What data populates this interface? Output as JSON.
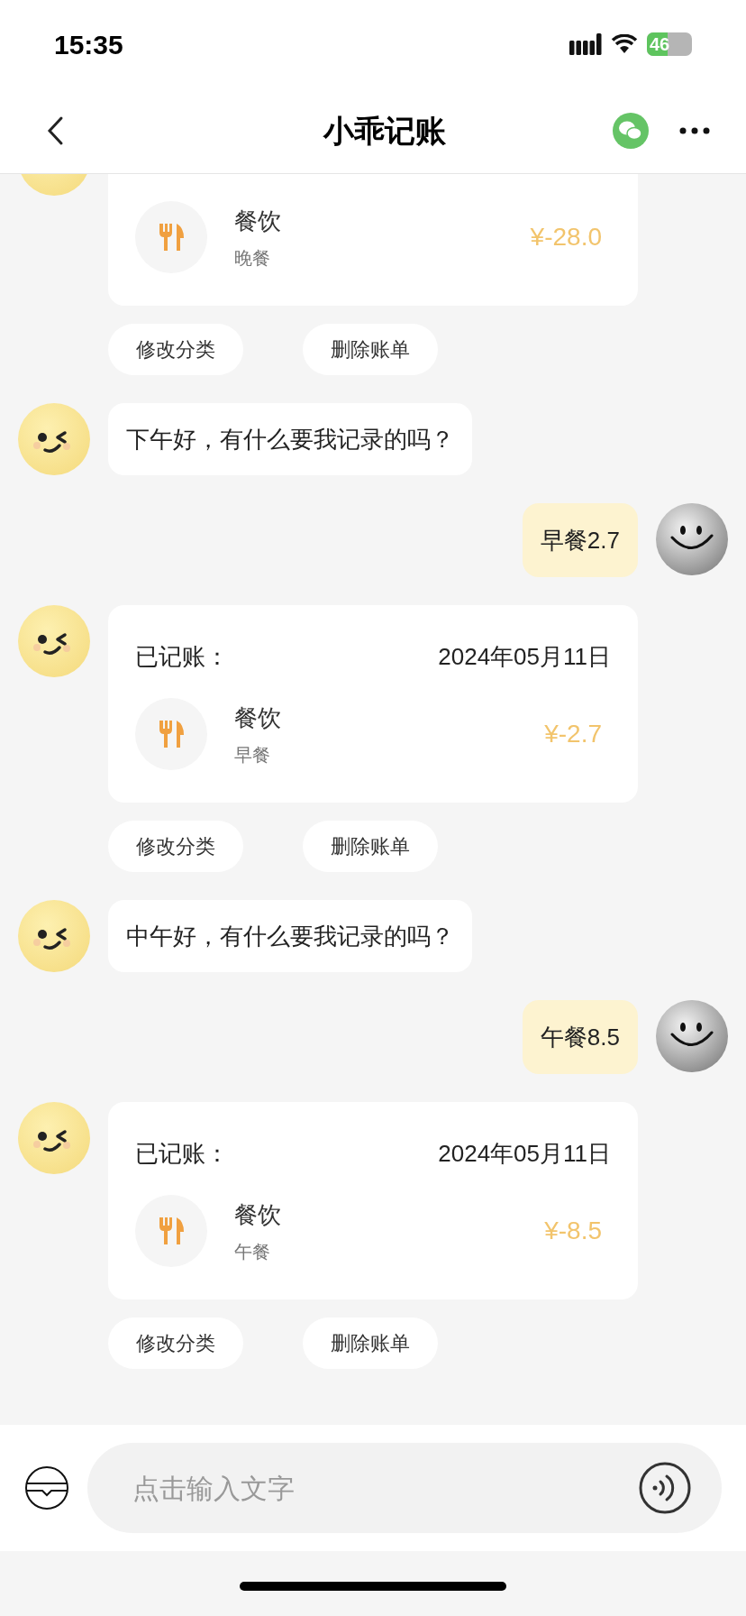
{
  "status_bar": {
    "time": "15:35",
    "battery": "46"
  },
  "header": {
    "title": "小乖记账"
  },
  "messages": [
    {
      "kind": "record",
      "category": "餐饮",
      "note": "晚餐",
      "amount": "¥-28.0",
      "actions": [
        "修改分类",
        "删除账单"
      ]
    },
    {
      "kind": "bot_text",
      "text": "下午好，有什么要我记录的吗？"
    },
    {
      "kind": "user_text",
      "text": "早餐2.7"
    },
    {
      "kind": "record",
      "title": "已记账：",
      "date": "2024年05月11日",
      "category": "餐饮",
      "note": "早餐",
      "amount": "¥-2.7",
      "actions": [
        "修改分类",
        "删除账单"
      ]
    },
    {
      "kind": "bot_text",
      "text": "中午好，有什么要我记录的吗？"
    },
    {
      "kind": "user_text",
      "text": "午餐8.5"
    },
    {
      "kind": "record",
      "title": "已记账：",
      "date": "2024年05月11日",
      "category": "餐饮",
      "note": "午餐",
      "amount": "¥-8.5",
      "actions": [
        "修改分类",
        "删除账单"
      ]
    }
  ],
  "input": {
    "placeholder": "点击输入文字"
  }
}
